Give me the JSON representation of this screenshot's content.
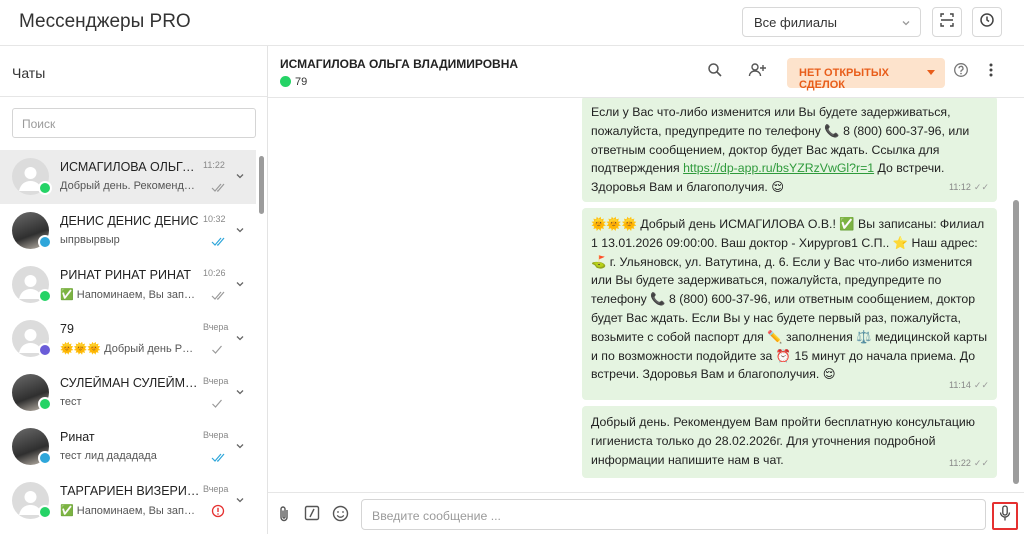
{
  "app": {
    "title": "Мессенджеры PRO"
  },
  "header": {
    "branch_select": "Все филиалы"
  },
  "sidebar": {
    "title": "Чаты",
    "search_placeholder": "Поиск",
    "chats": [
      {
        "name": "ИСМАГИЛОВА ОЛЬГА В...",
        "time": "11:22",
        "preview": "Добрый день. Рекомендуе...",
        "channel": "whatsapp",
        "status": "read-grey",
        "avatar": "placeholder",
        "active": true
      },
      {
        "name": "ДЕНИС ДЕНИС ДЕНИС",
        "time": "10:32",
        "preview": "ыпрвырвыр",
        "channel": "telegram",
        "status": "read-blue",
        "avatar": "photo"
      },
      {
        "name": "РИНАТ РИНАТ РИНАТ",
        "time": "10:26",
        "preview": "✅ Напоминаем, Вы запис...",
        "channel": "whatsapp",
        "status": "read-grey",
        "avatar": "placeholder"
      },
      {
        "name": "79",
        "time": "Вчера",
        "preview": "🌞🌞🌞 Добрый день РИ...",
        "channel": "viber",
        "status": "sent",
        "avatar": "placeholder"
      },
      {
        "name": "СУЛЕЙМАН СУЛЕЙМАН...",
        "time": "Вчера",
        "preview": "тест",
        "channel": "whatsapp",
        "status": "sent",
        "avatar": "photo"
      },
      {
        "name": "Ринат",
        "time": "Вчера",
        "preview": "тест лид дададада",
        "channel": "telegram",
        "status": "read-blue",
        "avatar": "photo"
      },
      {
        "name": "ТАРГАРИЕН ВИЗЕРИС Э...",
        "time": "Вчера",
        "preview": "✅ Напоминаем, Вы запис...",
        "channel": "whatsapp",
        "status": "error",
        "avatar": "placeholder"
      }
    ]
  },
  "chat": {
    "contact_name": "ИСМАГИЛОВА ОЛЬГА ВЛАДИМИРОВНА",
    "contact_phone": "79",
    "deals_button": "НЕТ ОТКРЫТЫХ СДЕЛОК",
    "messages": [
      {
        "text_before_link": "Если у Вас что-либо изменится или Вы будете задерживаться, пожалуйста, предупредите по телефону 📞 8 (800) 600-37-96, или ответным сообщением, доктор будет Вас ждать. Ссылка для подтверждения ",
        "link": "https://dp-app.ru/bsYZRzVwGl?r=1",
        "text_after_link": " До встречи. Здоровья Вам и благополучия. 😌",
        "time": "11:12"
      },
      {
        "text": "🌞🌞🌞 Добрый день ИСМАГИЛОВА О.В.! ✅ Вы записаны: Филиал 1 13.01.2026 09:00:00. Ваш доктор - Хирургов1 С.П.. ⭐ Наш адрес: ⛳ г. Ульяновск, ул. Ватутина, д. 6. Если у Вас что-либо изменится или Вы будете задерживаться, пожалуйста, предупредите по телефону 📞 8 (800) 600-37-96, или ответным сообщением, доктор будет Вас ждать. Если Вы у нас будете первый раз, пожалуйста, возьмите с собой паспорт для ✏️ заполнения ⚖️ медицинской карты и по возможности подойдите за ⏰ 15 минут до начала приема. До встречи. Здоровья Вам и благополучия. 😌",
        "time": "11:14"
      },
      {
        "text": "Добрый день. Рекомендуем Вам пройти бесплатную консультацию гигиениста только до 28.02.2026г. Для уточнения подробной информации напишите нам в чат.",
        "time": "11:22"
      }
    ],
    "composer_placeholder": "Введите сообщение ..."
  }
}
